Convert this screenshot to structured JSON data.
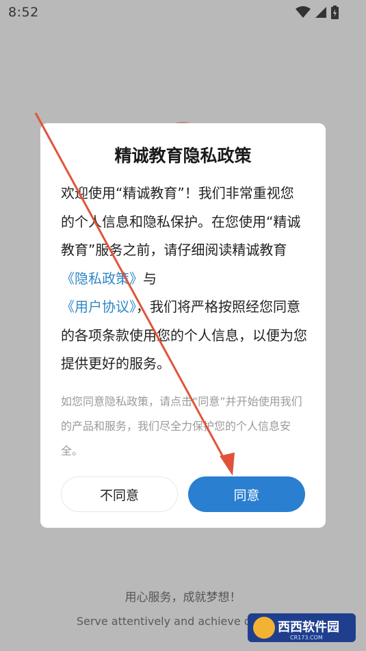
{
  "status_bar": {
    "time": "8:52"
  },
  "dialog": {
    "title": "精诚教育隐私政策",
    "body": {
      "p1": "欢迎使用“精诚教育”！我们非常重视您的个人信息和隐私保护。在您使用“精诚教育”服务之前，请仔细阅读精诚教育",
      "privacy_link": "《隐私政策》",
      "and": "与",
      "agreement_link": "《用户协议》",
      "p2": "，我们将严格按照经您同意的各项条款使用您的个人信息，以便为您提供更好的服务。"
    },
    "note": "如您同意隐私政策，请点击“同意”并开始使用我们的产品和服务，我们尽全力保护您的个人信息安全。",
    "buttons": {
      "disagree": "不同意",
      "agree": "同意"
    }
  },
  "footer": {
    "slogan_cn": "用心服务，成就梦想！",
    "slogan_en": "Serve attentively and achieve dreams!"
  },
  "watermark": {
    "brand": "西西软件园",
    "url": "CR173.COM"
  },
  "colors": {
    "accent": "#2a7fd0",
    "link": "#2f87c7",
    "arrow": "#e0533a",
    "overlay": "#b9b9b9"
  }
}
